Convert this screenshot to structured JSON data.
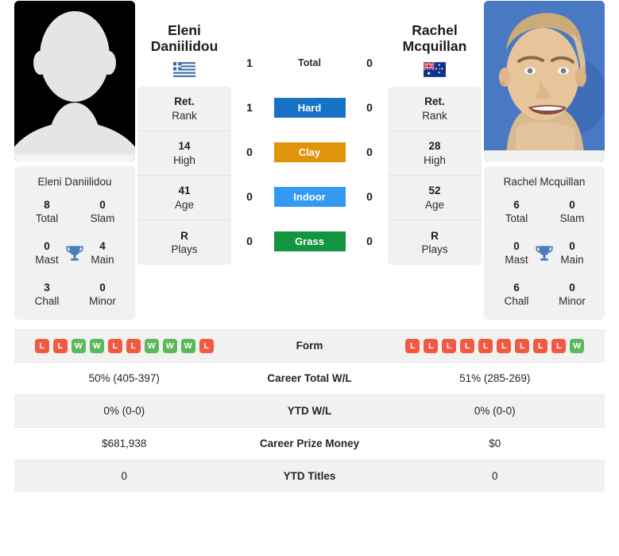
{
  "players": {
    "left": {
      "name_line1": "Eleni",
      "name_line2": "Daniilidou",
      "full_name": "Eleni Daniilidou",
      "country": "Greece",
      "flag_icon": "greece-flag-icon",
      "photo_type": "placeholder-avatar",
      "titles": {
        "total": "8",
        "total_label": "Total",
        "slam": "0",
        "slam_label": "Slam",
        "mast": "0",
        "mast_label": "Mast",
        "main": "4",
        "main_label": "Main",
        "chall": "3",
        "chall_label": "Chall",
        "minor": "0",
        "minor_label": "Minor"
      },
      "stats": [
        {
          "value": "Ret.",
          "label": "Rank"
        },
        {
          "value": "14",
          "label": "High"
        },
        {
          "value": "41",
          "label": "Age"
        },
        {
          "value": "R",
          "label": "Plays"
        }
      ],
      "form": [
        "L",
        "L",
        "W",
        "W",
        "L",
        "L",
        "W",
        "W",
        "W",
        "L"
      ],
      "career_total_wl": "50% (405-397)",
      "ytd_wl": "0% (0-0)",
      "career_prize_money": "$681,938",
      "ytd_titles": "0"
    },
    "right": {
      "name_line1": "Rachel",
      "name_line2": "Mcquillan",
      "full_name": "Rachel Mcquillan",
      "country": "Australia",
      "flag_icon": "australia-flag-icon",
      "photo_type": "headshot-photo",
      "titles": {
        "total": "6",
        "total_label": "Total",
        "slam": "0",
        "slam_label": "Slam",
        "mast": "0",
        "mast_label": "Mast",
        "main": "0",
        "main_label": "Main",
        "chall": "6",
        "chall_label": "Chall",
        "minor": "0",
        "minor_label": "Minor"
      },
      "stats": [
        {
          "value": "Ret.",
          "label": "Rank"
        },
        {
          "value": "28",
          "label": "High"
        },
        {
          "value": "52",
          "label": "Age"
        },
        {
          "value": "R",
          "label": "Plays"
        }
      ],
      "form": [
        "L",
        "L",
        "L",
        "L",
        "L",
        "L",
        "L",
        "L",
        "L",
        "W"
      ],
      "career_total_wl": "51% (285-269)",
      "ytd_wl": "0% (0-0)",
      "career_prize_money": "$0",
      "ytd_titles": "0"
    }
  },
  "head_to_head": [
    {
      "label": "Total",
      "left": "1",
      "right": "0",
      "badge": false,
      "color": ""
    },
    {
      "label": "Hard",
      "left": "1",
      "right": "0",
      "badge": true,
      "color": "#1572c4"
    },
    {
      "label": "Clay",
      "left": "0",
      "right": "0",
      "badge": true,
      "color": "#e0930b"
    },
    {
      "label": "Indoor",
      "left": "0",
      "right": "0",
      "badge": true,
      "color": "#3399f3"
    },
    {
      "label": "Grass",
      "left": "0",
      "right": "0",
      "badge": true,
      "color": "#11953f"
    }
  ],
  "table_rows": [
    {
      "label": "Form",
      "type": "form"
    },
    {
      "label": "Career Total W/L",
      "type": "text",
      "key": "career_total_wl"
    },
    {
      "label": "YTD W/L",
      "type": "text",
      "key": "ytd_wl"
    },
    {
      "label": "Career Prize Money",
      "type": "text",
      "key": "career_prize_money"
    },
    {
      "label": "YTD Titles",
      "type": "text",
      "key": "ytd_titles"
    }
  ],
  "colors": {
    "win_badge": "#5cb85c",
    "loss_badge": "#f05a41",
    "card_bg": "#f1f1f2",
    "trophy": "#4a7ebb"
  }
}
